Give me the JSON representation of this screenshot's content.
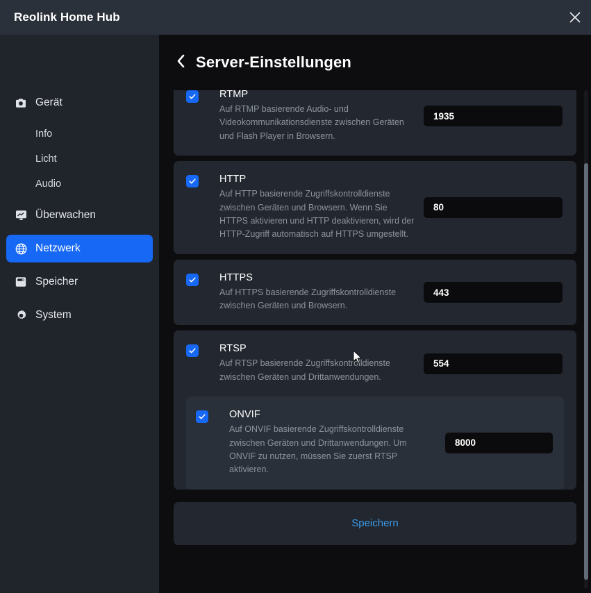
{
  "window": {
    "title": "Reolink Home Hub",
    "close_icon": "close-icon"
  },
  "sidebar": {
    "items": [
      {
        "label": "Gerät",
        "icon": "camera-icon",
        "type": "group",
        "active": false
      },
      {
        "label": "Info",
        "icon": "",
        "type": "sub",
        "active": false
      },
      {
        "label": "Licht",
        "icon": "",
        "type": "sub",
        "active": false
      },
      {
        "label": "Audio",
        "icon": "",
        "type": "sub",
        "active": false
      },
      {
        "label": "Überwachen",
        "icon": "monitor-icon",
        "type": "group",
        "active": false
      },
      {
        "label": "Netzwerk",
        "icon": "globe-icon",
        "type": "group",
        "active": true
      },
      {
        "label": "Speicher",
        "icon": "storage-icon",
        "type": "group",
        "active": false
      },
      {
        "label": "System",
        "icon": "gear-icon",
        "type": "group",
        "active": false
      }
    ]
  },
  "page": {
    "title": "Server-Einstellungen",
    "back_icon": "chevron-left-icon"
  },
  "services": [
    {
      "name": "RTMP",
      "description": "Auf RTMP basierende Audio- und Videokommunikationsdienste zwischen Geräten und Flash Player in Browsern.",
      "port": "1935",
      "enabled": true
    },
    {
      "name": "HTTP",
      "description": "Auf HTTP basierende Zugriffskontrolldienste zwischen Geräten und Browsern. Wenn Sie HTTPS aktivieren und HTTP deaktivieren, wird der HTTP-Zugriff automatisch auf HTTPS umgestellt.",
      "port": "80",
      "enabled": true
    },
    {
      "name": "HTTPS",
      "description": "Auf HTTPS basierende Zugriffskontrolldienste zwischen Geräten und Browsern.",
      "port": "443",
      "enabled": true
    },
    {
      "name": "RTSP",
      "description": "Auf RTSP basierende Zugriffskontrolldienste zwischen Geräten und Drittanwendungen.",
      "port": "554",
      "enabled": true
    }
  ],
  "nested_service": {
    "name": "ONVIF",
    "description": "Auf ONVIF basierende Zugriffskontrolldienste zwischen Geräten und Drittanwendungen. Um ONVIF zu nutzen, müssen Sie zuerst RTSP aktivieren.",
    "port": "8000",
    "enabled": true
  },
  "actions": {
    "save_label": "Speichern"
  },
  "colors": {
    "accent": "#1668f5",
    "link": "#3b9ae8",
    "titlebar_bg": "#2b313b",
    "sidebar_bg": "#20242b",
    "card_bg": "#232830",
    "subcard_bg": "#2a3039",
    "input_bg": "#0b0b0d",
    "page_bg": "#0d0d0f"
  }
}
